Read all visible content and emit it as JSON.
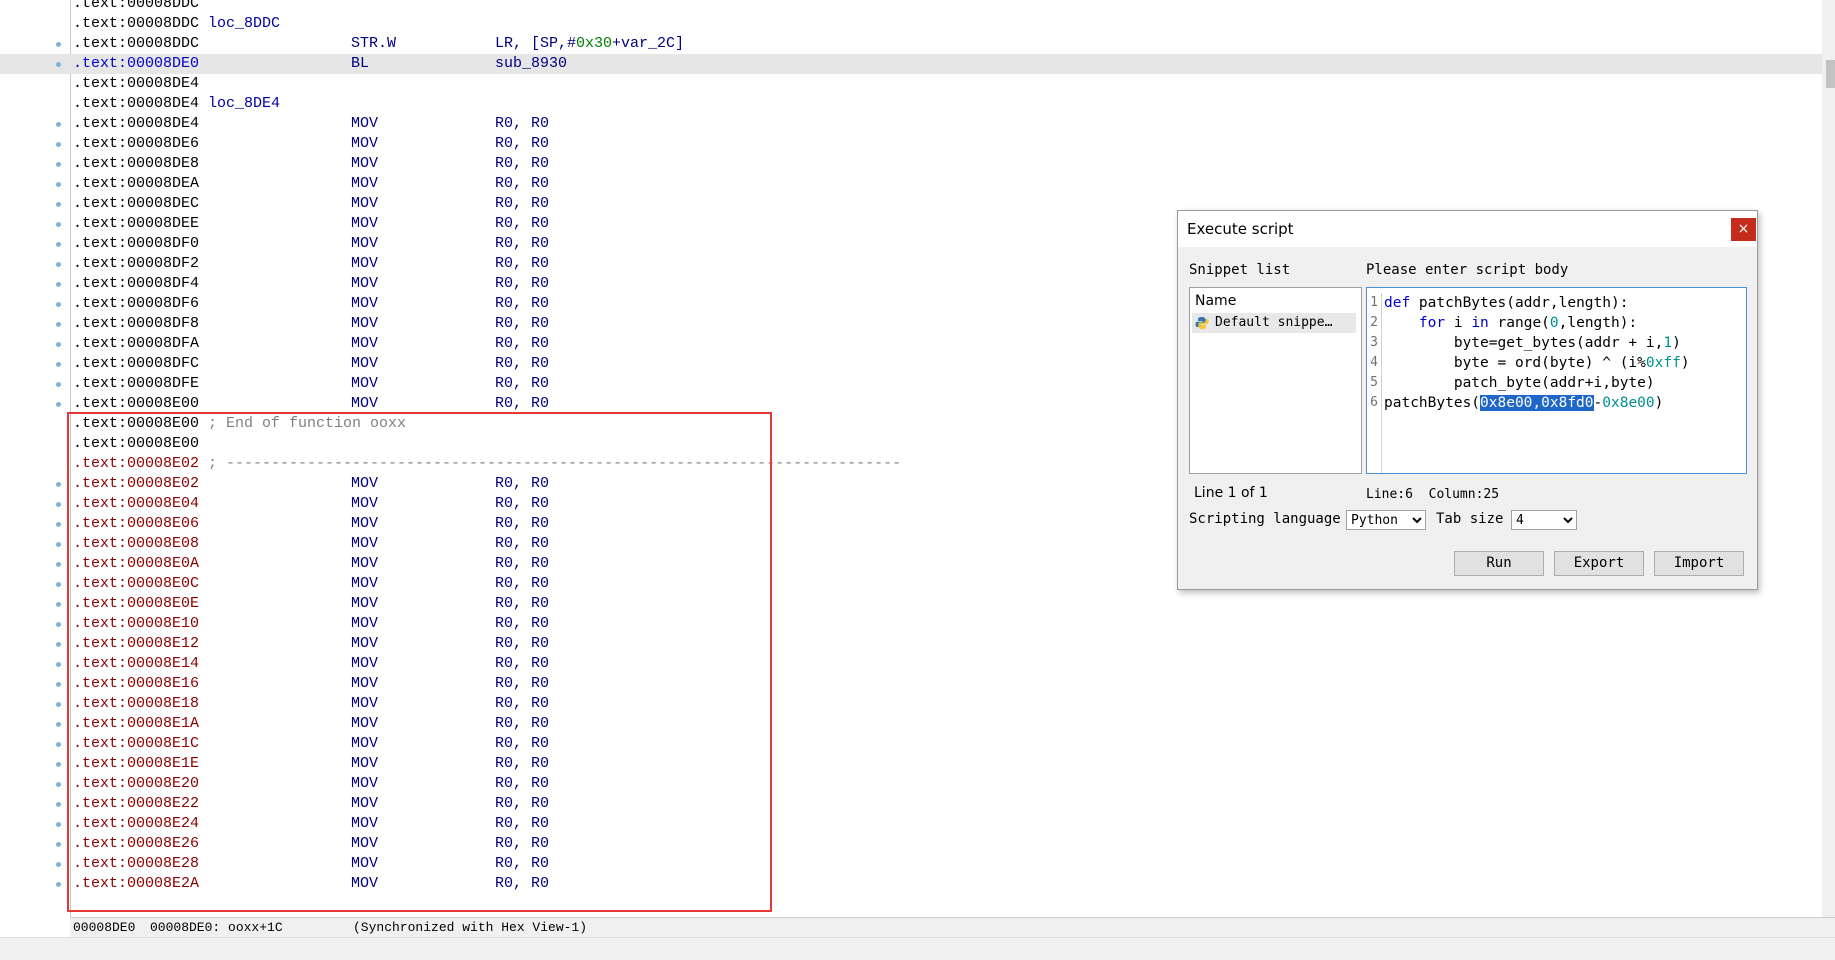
{
  "listing": [
    {
      "addr": ".text:00008DDC",
      "label": "",
      "mnemonic": "",
      "operands": "",
      "dot": false
    },
    {
      "addr": ".text:00008DDC",
      "label": "loc_8DDC",
      "mnemonic": "",
      "operands": "",
      "dot": false
    },
    {
      "addr": ".text:00008DDC",
      "label": "",
      "mnemonic": "STR.W",
      "operands": "LR, [SP,#",
      "op_green": "0x30",
      "op_tail": "+var_2C]",
      "dot": true
    },
    {
      "addr": ".text:00008DE0",
      "label": "",
      "mnemonic": "BL",
      "operands": "sub_8930",
      "dot": true,
      "highlight": true
    },
    {
      "addr": ".text:00008DE4",
      "label": "",
      "mnemonic": "",
      "operands": "",
      "dot": false
    },
    {
      "addr": ".text:00008DE4",
      "label": "loc_8DE4",
      "mnemonic": "",
      "operands": "",
      "dot": false
    },
    {
      "addr": ".text:00008DE4",
      "label": "",
      "mnemonic": "MOV",
      "operands": "R0, R0",
      "dot": true
    },
    {
      "addr": ".text:00008DE6",
      "label": "",
      "mnemonic": "MOV",
      "operands": "R0, R0",
      "dot": true
    },
    {
      "addr": ".text:00008DE8",
      "label": "",
      "mnemonic": "MOV",
      "operands": "R0, R0",
      "dot": true
    },
    {
      "addr": ".text:00008DEA",
      "label": "",
      "mnemonic": "MOV",
      "operands": "R0, R0",
      "dot": true
    },
    {
      "addr": ".text:00008DEC",
      "label": "",
      "mnemonic": "MOV",
      "operands": "R0, R0",
      "dot": true
    },
    {
      "addr": ".text:00008DEE",
      "label": "",
      "mnemonic": "MOV",
      "operands": "R0, R0",
      "dot": true
    },
    {
      "addr": ".text:00008DF0",
      "label": "",
      "mnemonic": "MOV",
      "operands": "R0, R0",
      "dot": true
    },
    {
      "addr": ".text:00008DF2",
      "label": "",
      "mnemonic": "MOV",
      "operands": "R0, R0",
      "dot": true
    },
    {
      "addr": ".text:00008DF4",
      "label": "",
      "mnemonic": "MOV",
      "operands": "R0, R0",
      "dot": true
    },
    {
      "addr": ".text:00008DF6",
      "label": "",
      "mnemonic": "MOV",
      "operands": "R0, R0",
      "dot": true
    },
    {
      "addr": ".text:00008DF8",
      "label": "",
      "mnemonic": "MOV",
      "operands": "R0, R0",
      "dot": true
    },
    {
      "addr": ".text:00008DFA",
      "label": "",
      "mnemonic": "MOV",
      "operands": "R0, R0",
      "dot": true
    },
    {
      "addr": ".text:00008DFC",
      "label": "",
      "mnemonic": "MOV",
      "operands": "R0, R0",
      "dot": true
    },
    {
      "addr": ".text:00008DFE",
      "label": "",
      "mnemonic": "MOV",
      "operands": "R0, R0",
      "dot": true
    },
    {
      "addr": ".text:00008E00",
      "label": "",
      "mnemonic": "MOV",
      "operands": "R0, R0",
      "dot": true
    },
    {
      "addr": ".text:00008E00",
      "comment": "; End of function ooxx",
      "mnemonic": "",
      "operands": "",
      "dot": false
    },
    {
      "addr": ".text:00008E00",
      "label": "",
      "mnemonic": "",
      "operands": "",
      "dot": false
    },
    {
      "addr": ".text:00008E02",
      "comment": "; ---------------------------------------------------------------------------",
      "mnemonic": "",
      "operands": "",
      "dot": false,
      "red": true
    },
    {
      "addr": ".text:00008E02",
      "label": "",
      "mnemonic": "MOV",
      "operands": "R0, R0",
      "dot": true,
      "red": true
    },
    {
      "addr": ".text:00008E04",
      "label": "",
      "mnemonic": "MOV",
      "operands": "R0, R0",
      "dot": true,
      "red": true
    },
    {
      "addr": ".text:00008E06",
      "label": "",
      "mnemonic": "MOV",
      "operands": "R0, R0",
      "dot": true,
      "red": true
    },
    {
      "addr": ".text:00008E08",
      "label": "",
      "mnemonic": "MOV",
      "operands": "R0, R0",
      "dot": true,
      "red": true
    },
    {
      "addr": ".text:00008E0A",
      "label": "",
      "mnemonic": "MOV",
      "operands": "R0, R0",
      "dot": true,
      "red": true
    },
    {
      "addr": ".text:00008E0C",
      "label": "",
      "mnemonic": "MOV",
      "operands": "R0, R0",
      "dot": true,
      "red": true
    },
    {
      "addr": ".text:00008E0E",
      "label": "",
      "mnemonic": "MOV",
      "operands": "R0, R0",
      "dot": true,
      "red": true
    },
    {
      "addr": ".text:00008E10",
      "label": "",
      "mnemonic": "MOV",
      "operands": "R0, R0",
      "dot": true,
      "red": true
    },
    {
      "addr": ".text:00008E12",
      "label": "",
      "mnemonic": "MOV",
      "operands": "R0, R0",
      "dot": true,
      "red": true
    },
    {
      "addr": ".text:00008E14",
      "label": "",
      "mnemonic": "MOV",
      "operands": "R0, R0",
      "dot": true,
      "red": true
    },
    {
      "addr": ".text:00008E16",
      "label": "",
      "mnemonic": "MOV",
      "operands": "R0, R0",
      "dot": true,
      "red": true
    },
    {
      "addr": ".text:00008E18",
      "label": "",
      "mnemonic": "MOV",
      "operands": "R0, R0",
      "dot": true,
      "red": true
    },
    {
      "addr": ".text:00008E1A",
      "label": "",
      "mnemonic": "MOV",
      "operands": "R0, R0",
      "dot": true,
      "red": true
    },
    {
      "addr": ".text:00008E1C",
      "label": "",
      "mnemonic": "MOV",
      "operands": "R0, R0",
      "dot": true,
      "red": true
    },
    {
      "addr": ".text:00008E1E",
      "label": "",
      "mnemonic": "MOV",
      "operands": "R0, R0",
      "dot": true,
      "red": true
    },
    {
      "addr": ".text:00008E20",
      "label": "",
      "mnemonic": "MOV",
      "operands": "R0, R0",
      "dot": true,
      "red": true
    },
    {
      "addr": ".text:00008E22",
      "label": "",
      "mnemonic": "MOV",
      "operands": "R0, R0",
      "dot": true,
      "red": true
    },
    {
      "addr": ".text:00008E24",
      "label": "",
      "mnemonic": "MOV",
      "operands": "R0, R0",
      "dot": true,
      "red": true
    },
    {
      "addr": ".text:00008E26",
      "label": "",
      "mnemonic": "MOV",
      "operands": "R0, R0",
      "dot": true,
      "red": true
    },
    {
      "addr": ".text:00008E28",
      "label": "",
      "mnemonic": "MOV",
      "operands": "R0, R0",
      "dot": true,
      "red": true
    },
    {
      "addr": ".text:00008E2A",
      "label": "",
      "mnemonic": "MOV",
      "operands": "R0, R0",
      "dot": true,
      "red": true
    }
  ],
  "status": {
    "offset": "00008DE0",
    "location": "00008DE0: ooxx+1C",
    "sync": "(Synchronized with Hex View-1)"
  },
  "dialog": {
    "title": "Execute script",
    "close": "×",
    "snippet_list_label": "Snippet list",
    "script_body_label": "Please enter script body",
    "name_header": "Name",
    "snippet_item": "Default snippe…",
    "line_info": "Line 1 of 1",
    "cursor_pos": "Line:6  Column:25",
    "scripting_language_label": "Scripting language",
    "scripting_language": "Python",
    "tab_size_label": "Tab size",
    "tab_size": "4",
    "run": "Run",
    "export": "Export",
    "import": "Import",
    "line_numbers": [
      "1",
      "2",
      "3",
      "4",
      "5",
      "6"
    ],
    "code": {
      "l1_kw": "def",
      "l1_rest": " patchBytes(addr,length):",
      "l2_indent": "    ",
      "l2_kw1": "for",
      "l2_mid": " i ",
      "l2_kw2": "in",
      "l2_a": " range(",
      "l2_num": "0",
      "l2_b": ",length):",
      "l3_a": "        byte=get_bytes(addr + i,",
      "l3_num": "1",
      "l3_b": ")",
      "l4_a": "        byte = ord(byte) ^ (i%",
      "l4_num": "0xff",
      "l4_b": ")",
      "l5": "        patch_byte(addr+i,byte)",
      "l6_a": "patchBytes(",
      "l6_sel": "0x8e00,0x8fd0",
      "l6_b": "-",
      "l6_num": "0x8e00",
      "l6_c": ")"
    }
  },
  "colors": {
    "highlight_row": "#e6e6e6",
    "red_box": "#e53935",
    "address_red": "#8b0000",
    "selection": "#1e66c8"
  }
}
